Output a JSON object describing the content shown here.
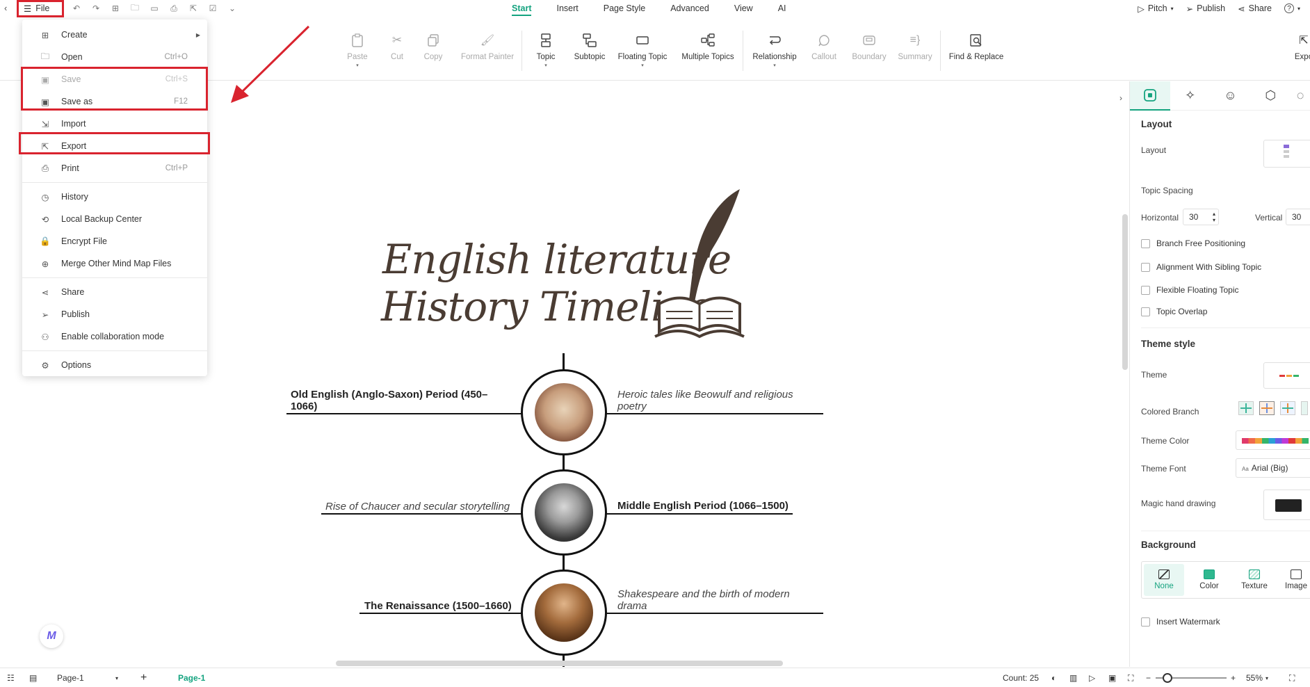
{
  "topbar": {
    "file_label": "File",
    "tabs": [
      {
        "label": "Start",
        "active": true
      },
      {
        "label": "Insert"
      },
      {
        "label": "Page Style"
      },
      {
        "label": "Advanced"
      },
      {
        "label": "View"
      },
      {
        "label": "AI"
      }
    ],
    "pitch": "Pitch",
    "publish": "Publish",
    "share": "Share",
    "help": "?"
  },
  "ribbon": {
    "paste": "Paste",
    "cut": "Cut",
    "copy": "Copy",
    "format_painter": "Format Painter",
    "topic": "Topic",
    "subtopic": "Subtopic",
    "floating_topic": "Floating Topic",
    "multiple_topics": "Multiple Topics",
    "relationship": "Relationship",
    "callout": "Callout",
    "boundary": "Boundary",
    "summary": "Summary",
    "find_replace": "Find & Replace",
    "export_partial": "Expo"
  },
  "file_menu": {
    "create": "Create",
    "open": "Open",
    "open_sc": "Ctrl+O",
    "save": "Save",
    "save_sc": "Ctrl+S",
    "save_as": "Save as",
    "save_as_sc": "F12",
    "import": "Import",
    "export": "Export",
    "print": "Print",
    "print_sc": "Ctrl+P",
    "history": "History",
    "backup": "Local Backup Center",
    "encrypt": "Encrypt File",
    "merge": "Merge Other Mind Map Files",
    "share": "Share",
    "publish": "Publish",
    "collab": "Enable collaboration mode",
    "options": "Options"
  },
  "canvas": {
    "title_line1": "English literature",
    "title_line2": "History Timeline",
    "nodes": [
      {
        "main": "Old English (Anglo-Saxon) Period (450–1066)",
        "note": "Heroic tales like Beowulf and religious poetry"
      },
      {
        "main": "Middle English Period (1066–1500)",
        "note": "Rise of Chaucer and secular storytelling"
      },
      {
        "main": "The Renaissance (1500–1660)",
        "note": "Shakespeare and the birth of modern drama"
      }
    ]
  },
  "panel": {
    "layout_h": "Layout",
    "layout_l": "Layout",
    "topic_spacing": "Topic Spacing",
    "horizontal": "Horizontal",
    "horizontal_val": "30",
    "vertical": "Vertical",
    "vertical_val": "30",
    "branch_free": "Branch Free Positioning",
    "align_sibling": "Alignment With Sibling Topic",
    "flexible_floating": "Flexible Floating Topic",
    "topic_overlap": "Topic Overlap",
    "theme_style_h": "Theme style",
    "theme": "Theme",
    "colored_branch": "Colored Branch",
    "theme_color": "Theme Color",
    "theme_font": "Theme Font",
    "theme_font_val": "Arial (Big)",
    "magic_hand": "Magic hand drawing",
    "background_h": "Background",
    "bg_none": "None",
    "bg_color": "Color",
    "bg_texture": "Texture",
    "bg_image": "Image",
    "insert_watermark": "Insert Watermark"
  },
  "statusbar": {
    "page_select": "Page-1",
    "page_tab": "Page-1",
    "count": "Count: 25",
    "zoom": "55%"
  },
  "colors": {
    "accent": "#14a37f",
    "highlight": "#d9232e",
    "title_brown": "#4a3c33"
  }
}
